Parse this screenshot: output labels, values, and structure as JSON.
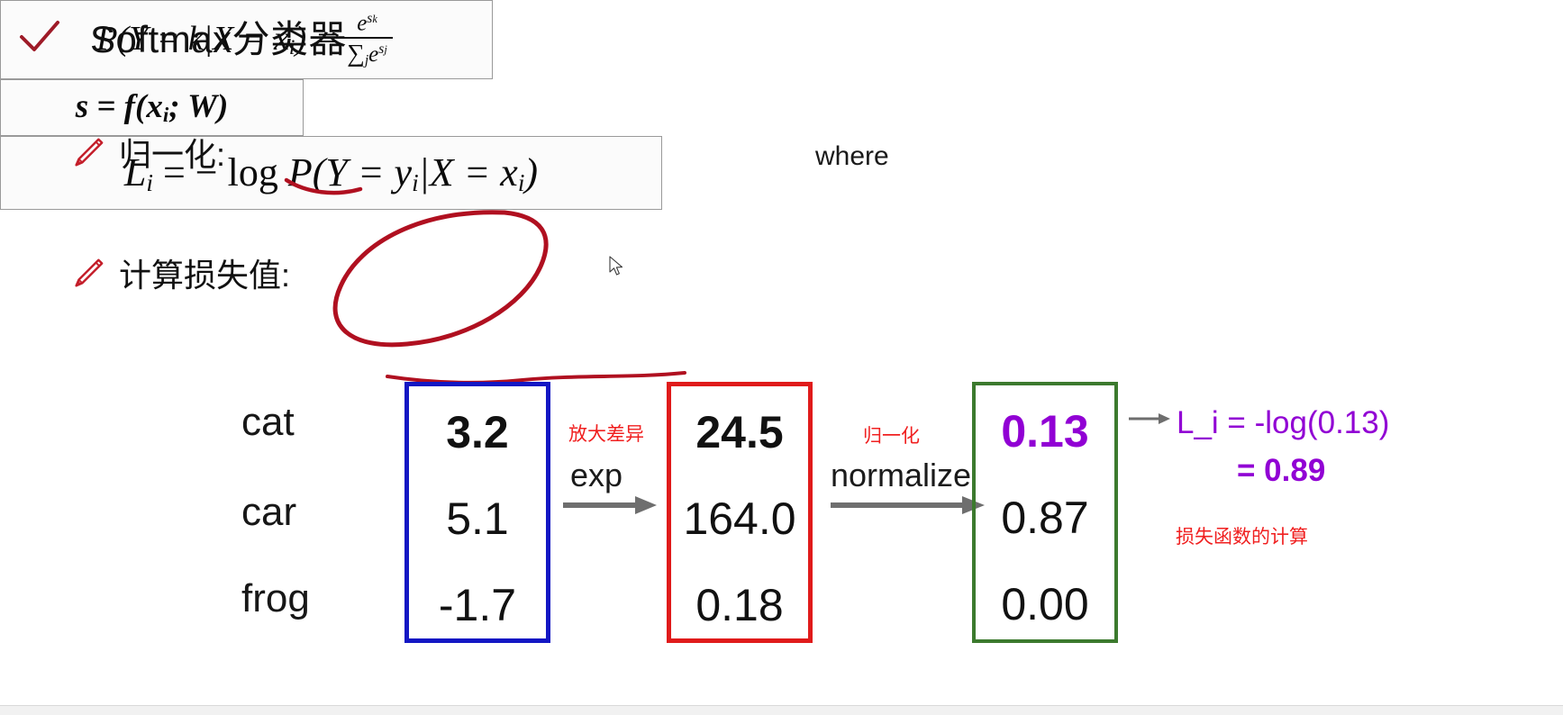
{
  "slide": {
    "title": "Softmax分类器",
    "title_icon": "check-icon",
    "bullets": [
      {
        "icon": "pen-icon",
        "label": "归一化:"
      },
      {
        "icon": "pen-icon",
        "label": "计算损失值:"
      }
    ],
    "formulas": {
      "normalize": {
        "lhs": "P(Y = k|X = x",
        "lhs_sub": "i",
        "lhs_tail": ") =",
        "numerator": "e",
        "numerator_sup": "s",
        "numerator_sup2": "k",
        "denominator_sigma": "∑",
        "denominator_sub": "j",
        "denominator_e": "e",
        "denominator_sup": "s",
        "denominator_sup2": "j",
        "plain": "P(Y = k|X = x_i) = e^{s_k} / Σ_j e^{s_j}"
      },
      "where_label": "where",
      "score": {
        "text": "s = f(x",
        "sub": "i",
        "tail": "; W)",
        "plain": "s = f(x_i; W)"
      },
      "loss": {
        "l": "L",
        "l_sub": "i",
        "eq": "= − log",
        "p": "P(Y = y",
        "p_sub": "i",
        "mid": "|X = x",
        "mid_sub": "i",
        "tail": ")",
        "plain": "L_i = -log P(Y = y_i|X = x_i)"
      }
    },
    "pipeline": {
      "row_labels": [
        "cat",
        "car",
        "frog"
      ],
      "columns": [
        {
          "name": "scores",
          "border_color": "#1317c4",
          "values": [
            "3.2",
            "5.1",
            "-1.7"
          ],
          "bold_index": 0
        },
        {
          "name": "unnormalized-probabilities",
          "border_color": "#e01b1b",
          "values": [
            "24.5",
            "164.0",
            "0.18"
          ],
          "bold_index": 0
        },
        {
          "name": "probabilities",
          "border_color": "#3c7a2e",
          "values": [
            "0.13",
            "0.87",
            "0.00"
          ],
          "bold_index": 0,
          "highlight_color": "#9100d4"
        }
      ],
      "operations": [
        {
          "name": "exp",
          "label": "exp",
          "annotation": "放大差异"
        },
        {
          "name": "normalize",
          "label": "normalize",
          "annotation": "归一化"
        }
      ],
      "result": {
        "line1": "L_i = -log(0.13)",
        "line2": "= 0.89",
        "annotation": "损失函数的计算",
        "color": "#9100d4"
      }
    },
    "colors": {
      "ink_red": "#b01020",
      "annotation_red": "#f02020",
      "purple": "#9100d4",
      "blue_box": "#1317c4",
      "red_box": "#e01b1b",
      "green_box": "#3c7a2e",
      "arrow_gray": "#6e6e6e"
    }
  }
}
